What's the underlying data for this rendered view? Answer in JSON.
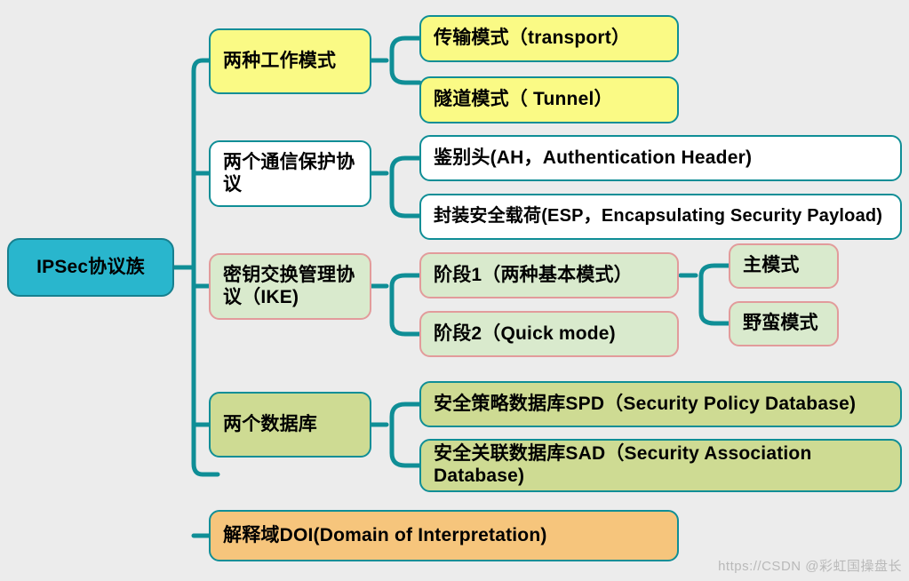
{
  "diagram": {
    "type": "mind-map",
    "background_color": "#ececec",
    "connector_color": "#0f8e96",
    "root": {
      "id": "root",
      "label": "IPSec协议族",
      "fill": "#29b6cd",
      "border": "#17808f"
    },
    "branches": [
      {
        "id": "work-modes",
        "label": "两种工作模式",
        "fill": "#fafa85",
        "border": "#0f8e96",
        "children": [
          {
            "id": "transport-mode",
            "label": "传输模式（transport）",
            "fill": "#fafa85",
            "border": "#0f8e96"
          },
          {
            "id": "tunnel-mode",
            "label": "隧道模式（ Tunnel）",
            "fill": "#fafa85",
            "border": "#0f8e96"
          }
        ]
      },
      {
        "id": "protection-protocols",
        "label": "两个通信保护协议",
        "fill": "#ffffff",
        "border": "#0f8e96",
        "children": [
          {
            "id": "ah",
            "label": "鉴别头(AH，Authentication Header)",
            "fill": "#ffffff",
            "border": "#0f8e96"
          },
          {
            "id": "esp",
            "label": "封装安全载荷(ESP，Encapsulating Security Payload)",
            "fill": "#ffffff",
            "border": "#0f8e96"
          }
        ]
      },
      {
        "id": "ike",
        "label": "密钥交换管理协议（IKE)",
        "fill": "#d9eacd",
        "border": "#e29b9b",
        "children": [
          {
            "id": "phase-1",
            "label": "阶段1（两种基本模式）",
            "fill": "#d9eacd",
            "border": "#e29b9b",
            "children": [
              {
                "id": "main-mode",
                "label": "主模式",
                "fill": "#d9eacd",
                "border": "#e29b9b"
              },
              {
                "id": "aggressive-mode",
                "label": "野蛮模式",
                "fill": "#d9eacd",
                "border": "#e29b9b"
              }
            ]
          },
          {
            "id": "phase-2",
            "label": "阶段2（Quick mode)",
            "fill": "#d9eacd",
            "border": "#e29b9b"
          }
        ]
      },
      {
        "id": "databases",
        "label": "两个数据库",
        "fill": "#cedb93",
        "border": "#0f8e96",
        "children": [
          {
            "id": "spd",
            "label": "安全策略数据库SPD（Security Policy Database)",
            "fill": "#cedb93",
            "border": "#0f8e96"
          },
          {
            "id": "sad",
            "label": "安全关联数据库SAD（Security Association Database)",
            "fill": "#cedb93",
            "border": "#0f8e96"
          }
        ]
      },
      {
        "id": "doi",
        "label": "解释域DOI(Domain of Interpretation)",
        "fill": "#f6c57c",
        "border": "#0f8e96",
        "children": []
      }
    ]
  },
  "watermark": {
    "text": "https://CSDN @彩虹国操盘长"
  }
}
